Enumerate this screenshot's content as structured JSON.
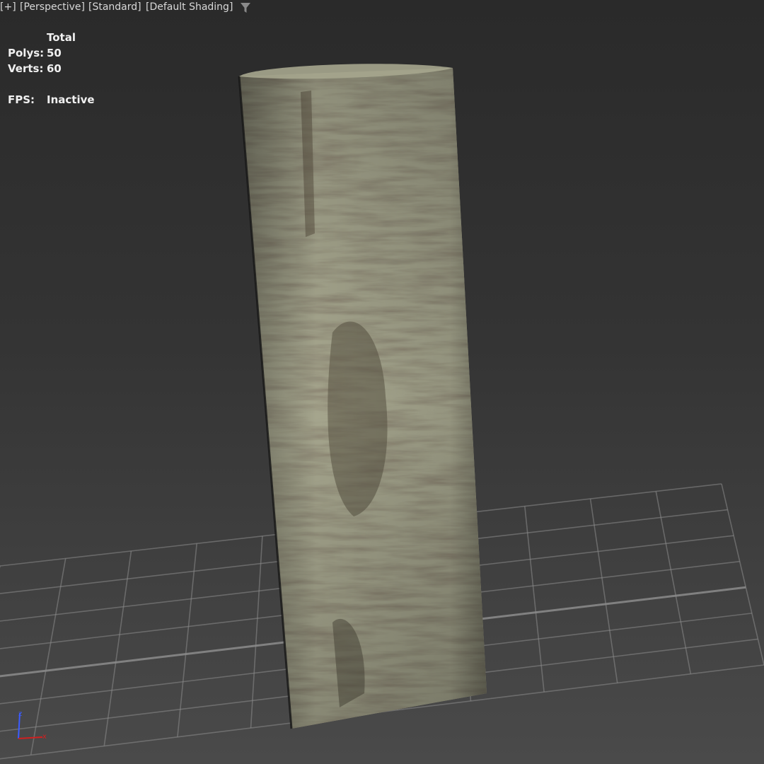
{
  "viewport": {
    "labels": {
      "menu": "[+]",
      "view": "[Perspective]",
      "mode": "[Standard]",
      "shading": "[Default Shading]"
    },
    "filter_icon": "filter-funnel-icon",
    "stats": {
      "header": "Total",
      "polys_label": "Polys:",
      "polys_value": "50",
      "verts_label": "Verts:",
      "verts_value": "60",
      "fps_label": "FPS:",
      "fps_value": "Inactive"
    },
    "axis": {
      "z": "z",
      "x": "x",
      "z_color": "#3c5cff",
      "x_color": "#d02020"
    }
  },
  "colors": {
    "bark_light": "#a6a68e",
    "bark_mid": "#7e7c66",
    "bark_dark": "#4a4636",
    "grid_line": "#8c8c8c"
  }
}
